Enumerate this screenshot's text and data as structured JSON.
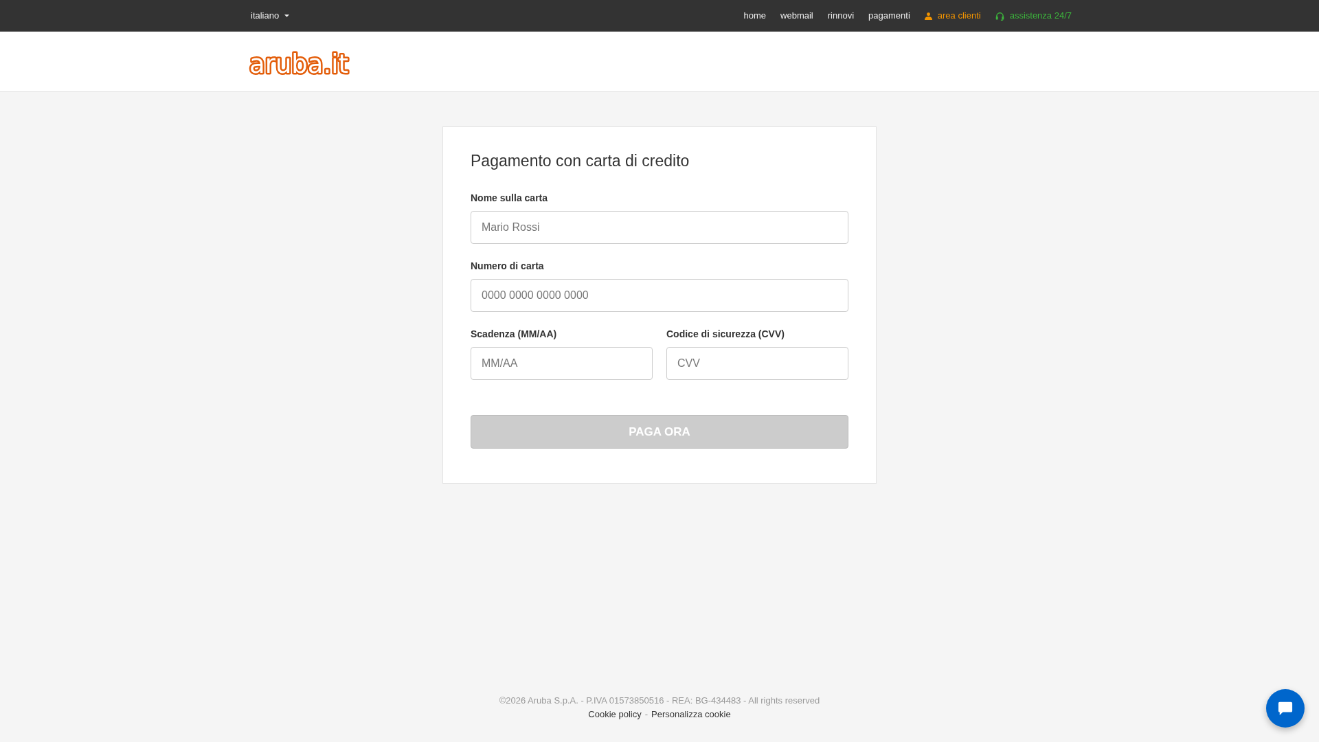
{
  "top_bar": {
    "language": "italiano",
    "links": [
      {
        "label": "home",
        "kind": "plain"
      },
      {
        "label": "webmail",
        "kind": "plain"
      },
      {
        "label": "rinnovi",
        "kind": "plain"
      },
      {
        "label": "pagamenti",
        "kind": "plain"
      },
      {
        "label": "area clienti",
        "kind": "account"
      },
      {
        "label": "assistenza 24/7",
        "kind": "support"
      }
    ]
  },
  "header": {
    "logo": "aruba.it"
  },
  "payment_form": {
    "title": "Pagamento con carta di credito",
    "rows": [
      {
        "fields": [
          {
            "label": "Nome sulla carta",
            "placeholder": "Mario Rossi"
          }
        ]
      },
      {
        "fields": [
          {
            "label": "Numero di carta",
            "placeholder": "0000 0000 0000 0000"
          }
        ]
      },
      {
        "fields": [
          {
            "label": "Scadenza (MM/AA)",
            "placeholder": "MM/AA"
          },
          {
            "label": "Codice di sicurezza (CVV)",
            "placeholder": "CVV"
          }
        ]
      }
    ],
    "submit": {
      "label": "PAGA ORA",
      "disabled": true
    }
  },
  "footer": {
    "legal": "©2026 Aruba S.p.A. - P.IVA 01573850516 - REA: BG-434483 - All rights reserved",
    "links": [
      "Cookie policy",
      "Personalizza cookie"
    ],
    "separator": "-"
  }
}
